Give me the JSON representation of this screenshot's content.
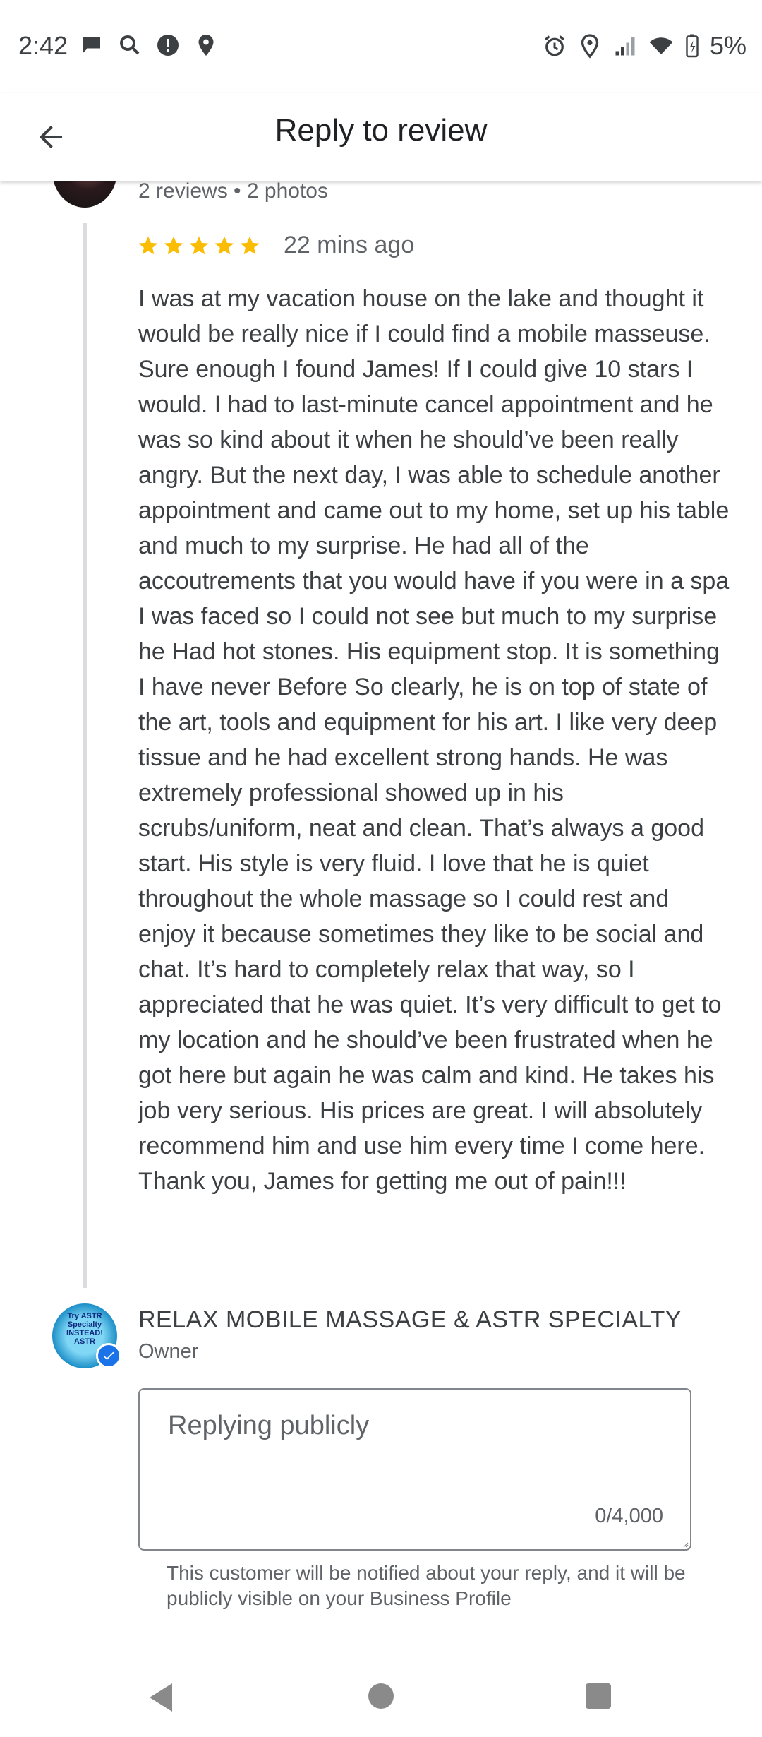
{
  "status_bar": {
    "time": "2:42",
    "left_icons": [
      "chat-bubble-icon",
      "search-icon",
      "alert-icon",
      "location-pin-icon"
    ],
    "right_icons": [
      "alarm-icon",
      "location-pin-icon",
      "signal-icon",
      "wifi-icon",
      "battery-icon"
    ],
    "battery_text": "5%"
  },
  "app_bar": {
    "title": "Reply to review",
    "back_icon": "arrow-left-icon"
  },
  "review": {
    "meta": "2 reviews • 2 photos",
    "rating": 5,
    "time_ago": "22 mins ago",
    "star_color": "#fbbc04",
    "text": "I was at my vacation house on the lake and thought it would be really nice if I could find a mobile masseuse. Sure enough I found James! If I could give 10 stars I would. I had to last-minute cancel appointment and he was so kind about it when he should’ve been really angry. But the next day, I was able to schedule another appointment and came out to my home, set up his table and much to my surprise. He had all of the accoutrements that you would have if you were in a spa I was faced so I could not see but much to my surprise he Had hot stones. His equipment stop. It is something I have never Before So clearly, he is on top of state of the art, tools and equipment for his art. I like very deep tissue and he had excellent strong hands. He was extremely professional showed up in his scrubs/uniform, neat and clean. That’s always a good start. His style is very fluid. I love that he is quiet throughout the whole massage so I could rest and enjoy it because sometimes they like to be social and chat. It’s hard to completely relax that way, so I appreciated that he was quiet. It’s very difficult to get to my location and he should’ve been frustrated when he got here but again he was calm and kind. He takes his job very serious. His prices are great. I will absolutely recommend him and use him every time I come here. Thank you, James for getting me out of pain!!!"
  },
  "owner": {
    "name": "RELAX MOBILE MASSAGE & ASTR SPECIALTY",
    "role": "Owner",
    "avatar_text": "Try ASTR Specialty INSTEAD! ASTR",
    "verified_color": "#1a73e8"
  },
  "reply": {
    "placeholder": "Replying publicly",
    "value": "",
    "counter": "0/4,000",
    "helper": "This customer will be notified about your reply, and it will be publicly visible on your Business Profile"
  },
  "nav_bar": {
    "icons": [
      "nav-back-icon",
      "nav-home-icon",
      "nav-recents-icon"
    ]
  }
}
